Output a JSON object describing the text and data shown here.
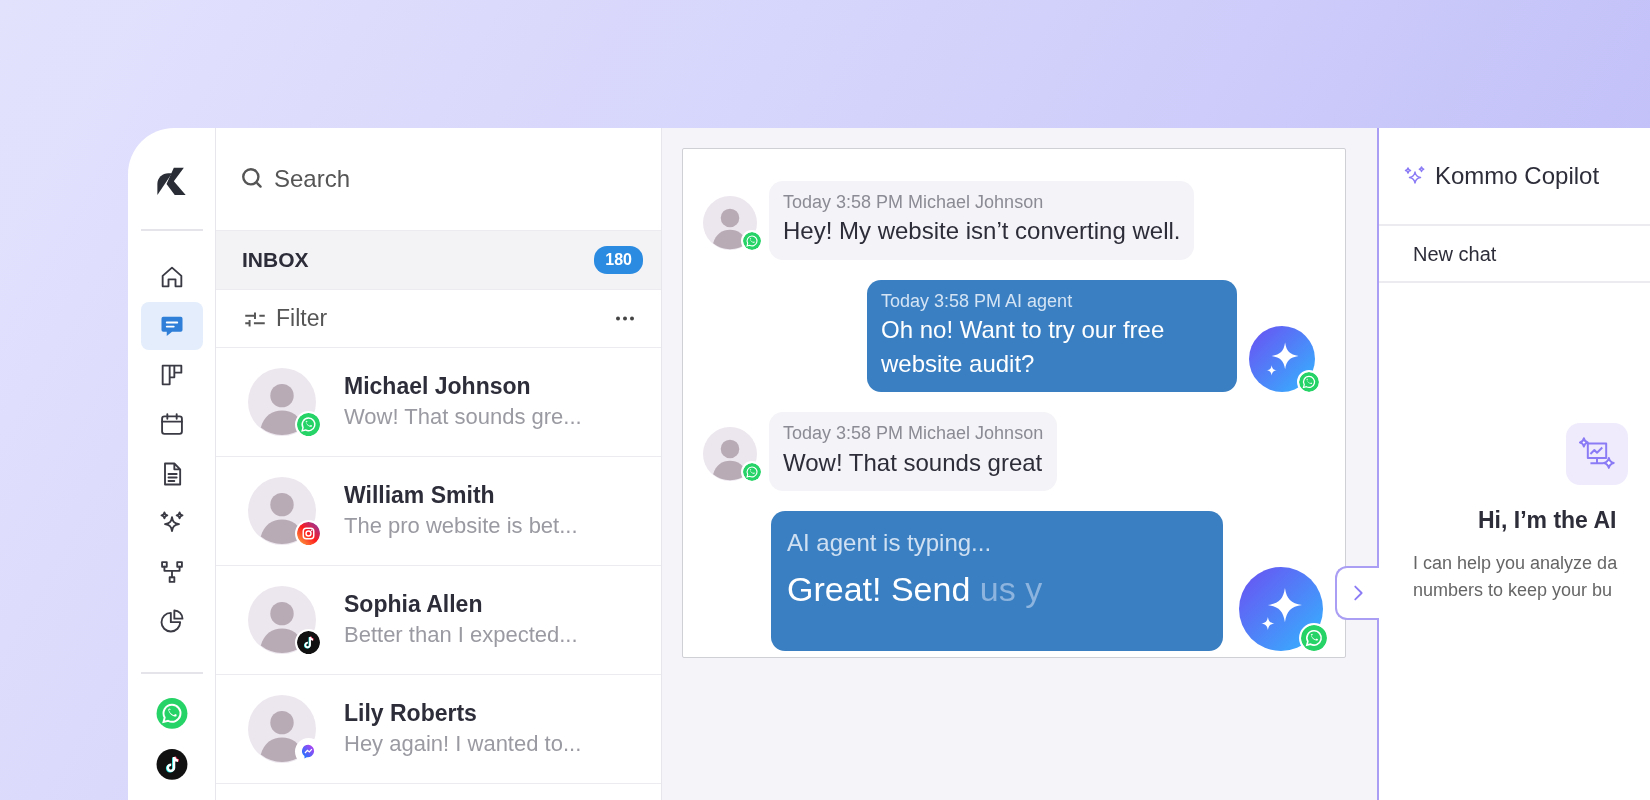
{
  "nav": {
    "items": [
      {
        "kind": "home",
        "selected": false
      },
      {
        "kind": "chats",
        "selected": true
      },
      {
        "kind": "board",
        "selected": false
      },
      {
        "kind": "calendar",
        "selected": false
      },
      {
        "kind": "document",
        "selected": false
      },
      {
        "kind": "sparkles",
        "selected": false
      },
      {
        "kind": "flow",
        "selected": false
      },
      {
        "kind": "pie",
        "selected": false
      }
    ],
    "channels": [
      {
        "kind": "whatsapp"
      },
      {
        "kind": "tiktok"
      }
    ]
  },
  "conversation_list": {
    "search": {
      "placeholder": "Search"
    },
    "inbox": {
      "title": "INBOX",
      "count": "180"
    },
    "filter": {
      "label": "Filter"
    },
    "conversations": [
      {
        "name": "Michael Johnson",
        "preview": "Wow! That sounds gre...",
        "channel": {
          "kind": "whatsapp"
        }
      },
      {
        "name": "William Smith",
        "preview": "The pro website is bet...",
        "channel": {
          "kind": "instagram"
        }
      },
      {
        "name": "Sophia Allen",
        "preview": "Better than I expected...",
        "channel": {
          "kind": "tiktok"
        }
      },
      {
        "name": "Lily Roberts",
        "preview": "Hey again! I wanted to...",
        "channel": {
          "kind": "messenger"
        }
      }
    ]
  },
  "chat": {
    "messages": [
      {
        "kind": "incoming",
        "meta": "Today 3:58 PM Michael Johnson",
        "text": "Hey! My website isn’t converting well.",
        "channel": {
          "kind": "whatsapp"
        }
      },
      {
        "kind": "outgoing",
        "meta": "Today 3:58 PM AI agent",
        "text": "Oh no! Want to try our free website audit?",
        "channel": {
          "kind": "whatsapp"
        }
      },
      {
        "kind": "incoming",
        "meta": "Today 3:58 PM Michael Johnson",
        "text": "Wow! That sounds great",
        "channel": {
          "kind": "whatsapp"
        }
      },
      {
        "kind": "typing",
        "meta": "AI agent is typing...",
        "text": "Great! Send",
        "pending_text": "us y",
        "channel": {
          "kind": "whatsapp"
        }
      }
    ]
  },
  "copilot": {
    "title": "Kommo Copilot",
    "new_chat": "New chat",
    "heading": "Hi, I’m the AI",
    "intro_lines": [
      "I can help you analyze da",
      "numbers to keep your bu"
    ]
  }
}
